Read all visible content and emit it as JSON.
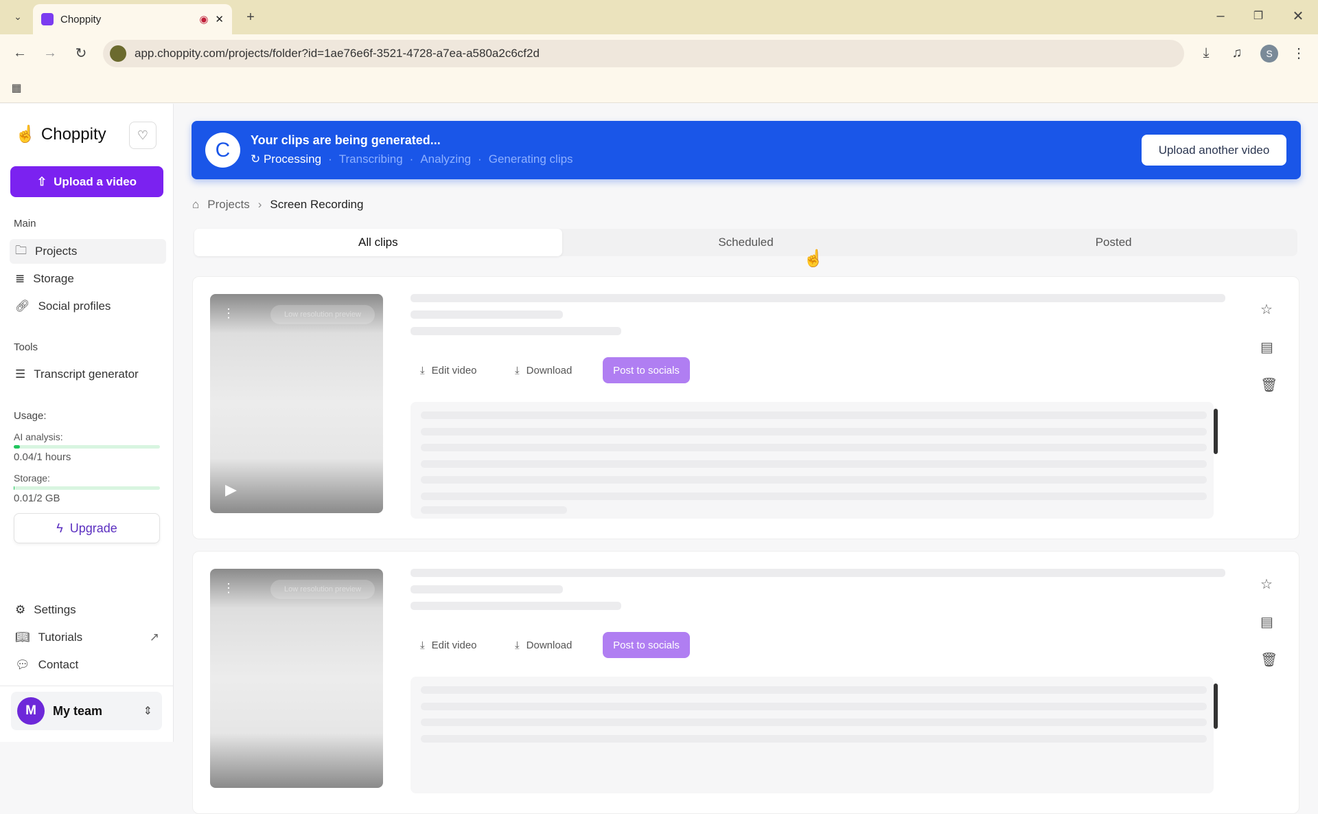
{
  "browser": {
    "tab_title": "Choppity",
    "url": "app.choppity.com/projects/folder?id=1ae76e6f-3521-4728-a7ea-a580a2c6cf2d",
    "profile_initial": "S"
  },
  "sidebar": {
    "brand": "Choppity",
    "upload_label": "Upload a video",
    "main_heading": "Main",
    "main_items": [
      {
        "label": "Projects"
      },
      {
        "label": "Storage"
      },
      {
        "label": "Social profiles"
      }
    ],
    "tools_heading": "Tools",
    "tools_items": [
      {
        "label": "Transcript generator"
      }
    ],
    "usage": {
      "heading": "Usage:",
      "ai_label": "AI analysis:",
      "ai_value": "0.04/1 hours",
      "ai_fraction": 0.04,
      "storage_label": "Storage:",
      "storage_value": "0.01/2 GB",
      "storage_fraction": 0.005
    },
    "upgrade_label": "Upgrade",
    "bottom_items": [
      {
        "label": "Settings"
      },
      {
        "label": "Tutorials"
      },
      {
        "label": "Contact"
      }
    ],
    "team": {
      "initial": "M",
      "name": "My team"
    }
  },
  "banner": {
    "title": "Your clips are being generated...",
    "steps": [
      "Processing",
      "Transcribing",
      "Analyzing",
      "Generating clips"
    ],
    "upload_another": "Upload another video"
  },
  "breadcrumb": {
    "root": "Projects",
    "current": "Screen Recording"
  },
  "tabs": [
    "All clips",
    "Scheduled",
    "Posted"
  ],
  "clips": [
    {
      "preview_badge": "Low resolution preview",
      "edit": "Edit video",
      "download": "Download",
      "post": "Post to socials"
    },
    {
      "preview_badge": "Low resolution preview",
      "edit": "Edit video",
      "download": "Download",
      "post": "Post to socials"
    }
  ],
  "colors": {
    "accent": "#7b22f0",
    "banner": "#1a56e8",
    "usage": "#22c55e"
  }
}
